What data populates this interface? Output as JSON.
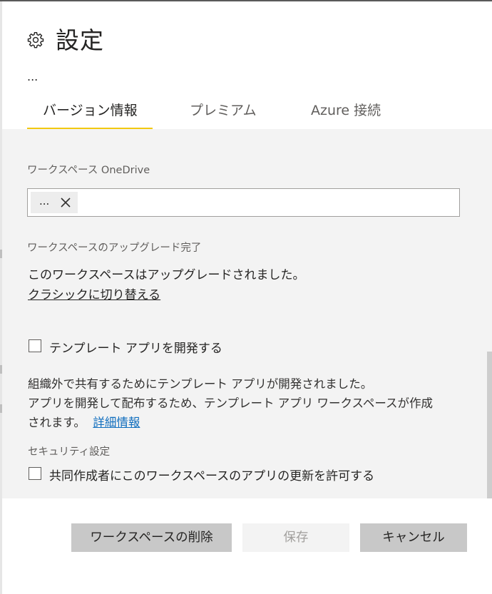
{
  "panel": {
    "title": "設定",
    "subtitle": "...",
    "tabs": [
      {
        "label": "バージョン情報",
        "active": true
      },
      {
        "label": "プレミアム",
        "active": false
      },
      {
        "label": "Azure 接続",
        "active": false
      }
    ]
  },
  "onedrive": {
    "label": "ワークスペース OneDrive",
    "chip_text": "..."
  },
  "upgrade": {
    "label": "ワークスペースのアップグレード完了",
    "message": "このワークスペースはアップグレードされました。",
    "switch_link": "クラシックに切り替える"
  },
  "template_app": {
    "checkbox_label": "テンプレート アプリを開発する",
    "checked": false,
    "description_line1": "組織外で共有するためにテンプレート アプリが開発されました。",
    "description_line2": "アプリを開発して配布するため、テンプレート アプリ ワークスペースが作成",
    "description_line3": "されます。",
    "learn_more": "詳細情報"
  },
  "security": {
    "label": "セキュリティ設定",
    "checkbox_label": "共同作成者にこのワークスペースのアプリの更新を許可する",
    "checked": false
  },
  "footer": {
    "delete_label": "ワークスペースの削除",
    "save_label": "保存",
    "cancel_label": "キャンセル"
  },
  "colors": {
    "accent": "#f2c811",
    "link": "#106ebe",
    "content_bg": "#f3f3f3"
  }
}
